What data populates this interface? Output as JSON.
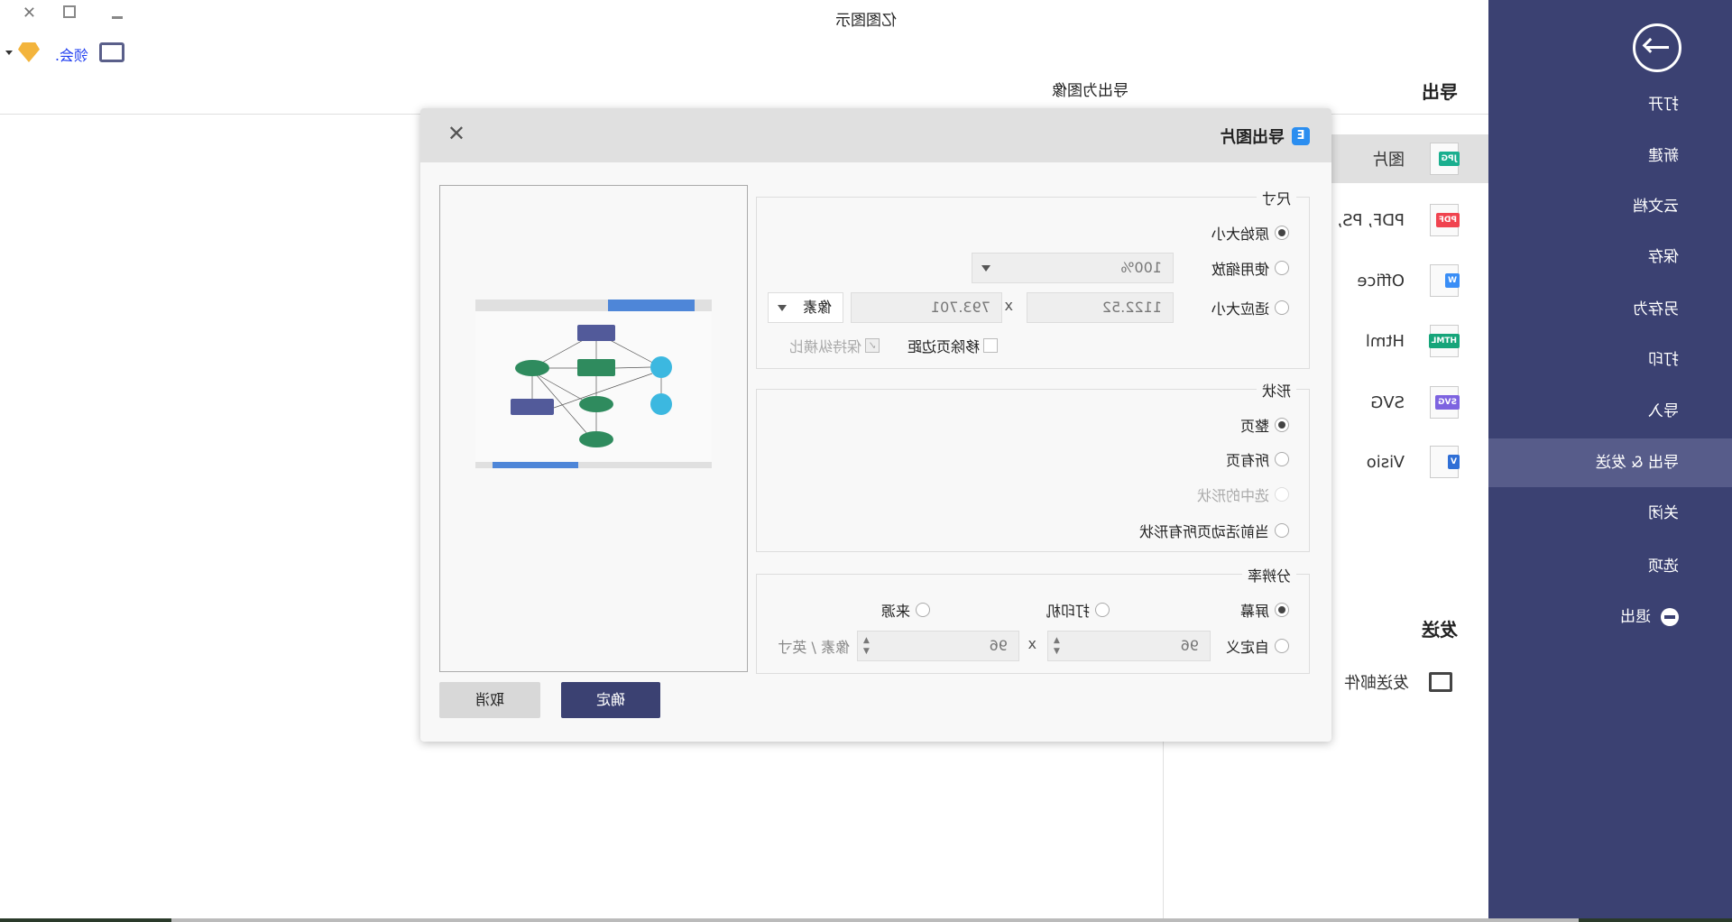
{
  "window": {
    "title": "亿图图示",
    "account_text": "领会.",
    "close_icon": "close-icon",
    "restore_icon": "restore-icon",
    "minimize_icon": "minimize-icon"
  },
  "sidebar": {
    "back_icon": "arrow-right-circle-icon",
    "items": [
      {
        "label": "打开"
      },
      {
        "label": "新建"
      },
      {
        "label": "云文档"
      },
      {
        "label": "保存"
      },
      {
        "label": "另存为"
      },
      {
        "label": "打印"
      },
      {
        "label": "导入"
      },
      {
        "label": "导出 & 发送",
        "selected": true
      },
      {
        "label": "关闭"
      },
      {
        "label": "选项"
      },
      {
        "label": "退出"
      }
    ]
  },
  "export_panel": {
    "heading": "导出",
    "subtitle": "导出为图像",
    "formats": [
      {
        "label": "图片",
        "badge": "JPG",
        "color": "#1aaf8f",
        "selected": true
      },
      {
        "label": "PDF, PS, EPS",
        "badge": "PDF",
        "color": "#f0434f"
      },
      {
        "label": "Office",
        "badge": "W",
        "color": "#3a8ef6"
      },
      {
        "label": "Html",
        "badge": "HTML",
        "color": "#16a57a"
      },
      {
        "label": "SVG",
        "badge": "SVG",
        "color": "#7d63e0"
      },
      {
        "label": "Visio",
        "badge": "V",
        "color": "#2f6fd6"
      }
    ],
    "send_heading": "发送",
    "send_email": "发送邮件"
  },
  "dialog": {
    "title": "导出图片",
    "size": {
      "label": "尺寸",
      "original": "原始大小",
      "use_zoom": "使用缩放",
      "zoom_value": "100%",
      "fit": "适应大小",
      "width": "1122.52",
      "x": "x",
      "height": "793.701",
      "unit": "像素",
      "remove_margin": "移除页边距",
      "keep_ratio": "保持纵横比"
    },
    "shape": {
      "label": "形状",
      "options": [
        "整页",
        "所有页",
        "选中的形状",
        "当前活动页所有形状"
      ]
    },
    "resolution": {
      "label": "分辨率",
      "screen": "屏幕",
      "printer": "打印机",
      "source": "来源",
      "custom": "自定义",
      "dpi_x": "96",
      "x": "x",
      "dpi_y": "96",
      "unit": "像素 / 英寸"
    },
    "ok": "确定",
    "cancel": "取消"
  },
  "colors": {
    "sidebar": "#3b4172",
    "accent": "#3b4172"
  }
}
